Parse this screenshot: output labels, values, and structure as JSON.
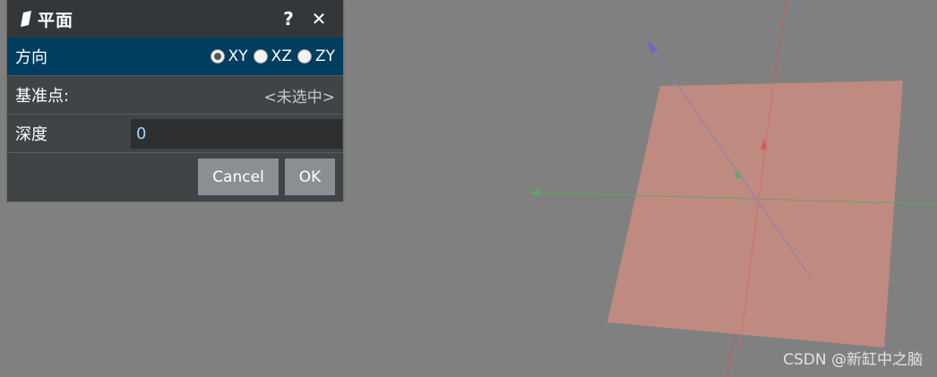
{
  "dialog": {
    "title": "平面",
    "help_label": "?",
    "close_label": "✕",
    "direction": {
      "label": "方向",
      "options": [
        "XY",
        "XZ",
        "ZY"
      ],
      "selected": "XY"
    },
    "base_point": {
      "label": "基准点:",
      "value": "<未选中>"
    },
    "depth": {
      "label": "深度",
      "value": "0"
    },
    "cancel_label": "Cancel",
    "ok_label": "OK"
  },
  "scene": {
    "plane_color": "#c28a80",
    "axis_colors": {
      "x": "#e05a5a",
      "y": "#4caf50",
      "z": "#6a6ad8"
    }
  },
  "watermark": "CSDN @新缸中之脑"
}
